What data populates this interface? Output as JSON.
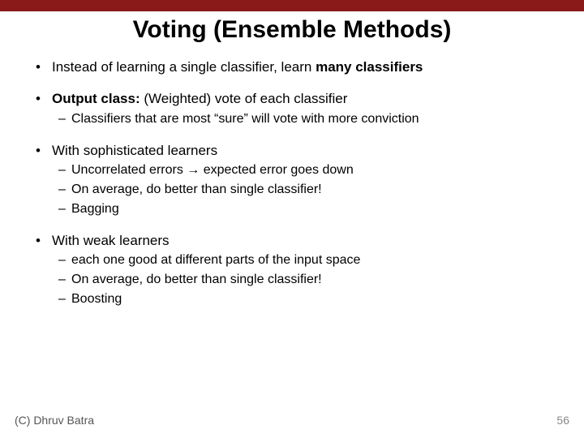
{
  "title": "Voting (Ensemble Methods)",
  "bullets": {
    "b1_pre": "Instead of learning a single classifier, learn ",
    "b1_bold": "many classifiers",
    "b2_bold": "Output class: ",
    "b2_rest": "(Weighted) vote of each classifier",
    "b2_sub1": "Classifiers that are most “sure” will vote with more conviction",
    "b3": "With sophisticated learners",
    "b3_sub1_a": "Uncorrelated errors ",
    "b3_sub1_b": " expected error goes down",
    "b3_sub2": "On average, do better than single classifier!",
    "b3_sub3": "Bagging",
    "b4": "With weak learners",
    "b4_sub1": "each one good at different parts of the input space",
    "b4_sub2": "On average, do better than single classifier!",
    "b4_sub3": "Boosting"
  },
  "arrow": "→",
  "footer_left": "(C) Dhruv Batra",
  "footer_right": "56"
}
